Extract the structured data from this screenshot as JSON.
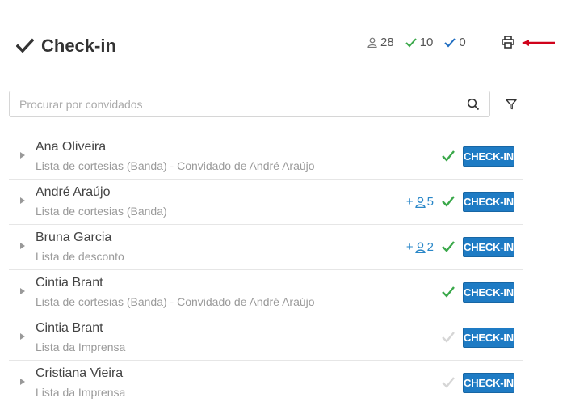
{
  "header": {
    "title": "Check-in",
    "title_icon": "checkmark-icon"
  },
  "stats": {
    "guests_total": "28",
    "checked_green": "10",
    "checked_blue": "0"
  },
  "colors": {
    "accent_blue": "#1e7bc4",
    "check_green": "#3aa84a",
    "check_blue": "#1e6cc0",
    "plus_blue": "#2a87c8",
    "check_inactive": "#d6d6d6",
    "annotation_red": "#d0021b"
  },
  "search": {
    "placeholder": "Procurar por convidados"
  },
  "guests": [
    {
      "name": "Ana Oliveira",
      "list": "Lista de cortesias (Banda) - Convidado de André Araújo",
      "plus": "",
      "checked": true,
      "button": "CHECK-IN"
    },
    {
      "name": "André Araújo",
      "list": "Lista de cortesias (Banda)",
      "plus": "5",
      "checked": true,
      "button": "CHECK-IN"
    },
    {
      "name": "Bruna Garcia",
      "list": "Lista de desconto",
      "plus": "2",
      "checked": true,
      "button": "CHECK-IN"
    },
    {
      "name": "Cintia Brant",
      "list": "Lista de cortesias (Banda) - Convidado de André Araújo",
      "plus": "",
      "checked": true,
      "button": "CHECK-IN"
    },
    {
      "name": "Cintia Brant",
      "list": "Lista da Imprensa",
      "plus": "",
      "checked": false,
      "button": "CHECK-IN"
    },
    {
      "name": "Cristiana Vieira",
      "list": "Lista da Imprensa",
      "plus": "",
      "checked": false,
      "button": "CHECK-IN"
    }
  ]
}
